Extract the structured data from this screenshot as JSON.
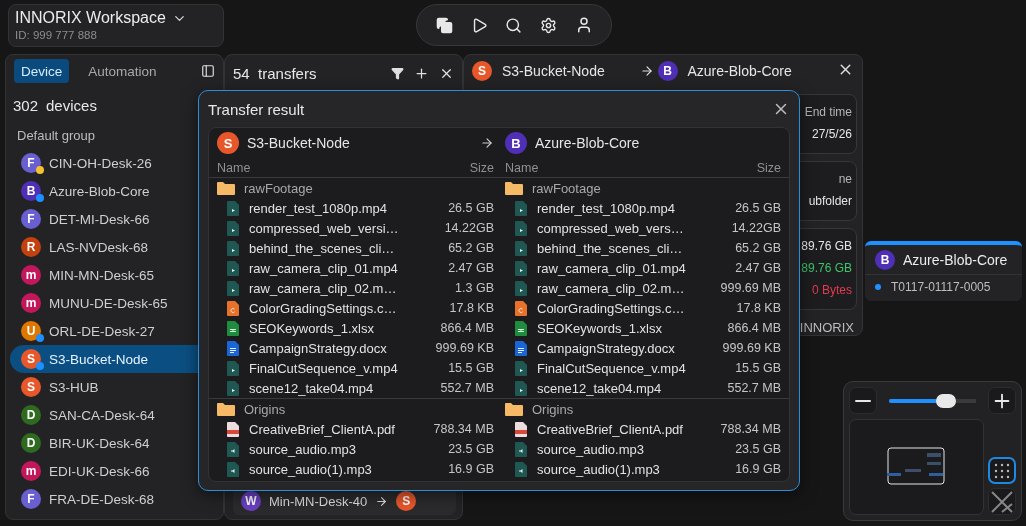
{
  "workspace": {
    "title": "INNORIX Workspace",
    "id": "ID: 999 777 888"
  },
  "device_panel": {
    "tabs": [
      {
        "label": "Device",
        "selected": true
      },
      {
        "label": "Automation",
        "selected": false
      }
    ],
    "count": "302",
    "count_label": "devices",
    "group": "Default group",
    "devices": [
      {
        "name": "CIN-OH-Desk-26",
        "avatar": {
          "letter": "F",
          "color": "#6a5fd0"
        },
        "status_dot": {
          "color": "#f2c230"
        },
        "selected": false
      },
      {
        "name": "Azure-Blob-Core",
        "avatar": {
          "letter": "B",
          "color": "#4f2fb5"
        },
        "status_dot": {
          "color": "#1e8fff"
        },
        "selected": false
      },
      {
        "name": "DET-MI-Desk-66",
        "avatar": {
          "letter": "F",
          "color": "#6a5fd0"
        },
        "selected": false
      },
      {
        "name": "LAS-NVDesk-68",
        "avatar": {
          "letter": "R",
          "color": "#c2410f"
        },
        "selected": false
      },
      {
        "name": "MIN-MN-Desk-65",
        "avatar": {
          "letter": "m",
          "color": "#c2185b"
        },
        "selected": false
      },
      {
        "name": "MUNU-DE-Desk-65",
        "avatar": {
          "letter": "m",
          "color": "#c2185b"
        },
        "selected": false
      },
      {
        "name": "ORL-DE-Desk-27",
        "avatar": {
          "letter": "U",
          "color": "#e07800"
        },
        "status_dot": {
          "color": "#1e8fff"
        },
        "selected": false
      },
      {
        "name": "S3-Bucket-Node",
        "avatar": {
          "letter": "S",
          "color": "#e8572a"
        },
        "status_dot": {
          "color": "#1e8fff"
        },
        "selected": true
      },
      {
        "name": "S3-HUB",
        "avatar": {
          "letter": "S",
          "color": "#e8572a"
        },
        "selected": false
      },
      {
        "name": "SAN-CA-Desk-64",
        "avatar": {
          "letter": "D",
          "color": "#2e6b1f"
        },
        "selected": false
      },
      {
        "name": "BIR-UK-Desk-64",
        "avatar": {
          "letter": "D",
          "color": "#2e6b1f"
        },
        "selected": false
      },
      {
        "name": "EDI-UK-Desk-66",
        "avatar": {
          "letter": "m",
          "color": "#c2185b"
        },
        "selected": false
      },
      {
        "name": "FRA-DE-Desk-68",
        "avatar": {
          "letter": "F",
          "color": "#6a5fd0"
        },
        "selected": false
      }
    ]
  },
  "transfers_panel": {
    "count": "54",
    "count_label": "transfers",
    "rows": [
      {
        "source": {
          "letter": "W",
          "color": "#6a3fc1"
        },
        "name": "Min-MN-Desk-40",
        "target": {
          "letter": "S",
          "color": "#e8572a"
        }
      }
    ]
  },
  "detail_panel": {
    "source": {
      "letter": "S",
      "color": "#e8572a",
      "name": "S3-Bucket-Node"
    },
    "target": {
      "letter": "B",
      "color": "#4f2fb5",
      "name": "Azure-Blob-Core"
    },
    "cards": [
      {
        "lines": [
          {
            "text": "End time",
            "kind": "muted"
          },
          {
            "text": "27/5/26",
            "kind": "normal"
          }
        ]
      },
      {
        "lines": [
          {
            "text": "ne",
            "kind": "muted"
          },
          {
            "text": "ubfolder",
            "kind": "normal"
          }
        ]
      },
      {
        "lines": [
          {
            "text": "89.76 GB",
            "kind": "normal"
          },
          {
            "text": "89.76 GB",
            "kind": "success"
          },
          {
            "text": "0 Bytes",
            "kind": "error"
          }
        ]
      }
    ],
    "footer": "INNORIX"
  },
  "canvas_node": {
    "avatar": {
      "letter": "B",
      "color": "#4f2fb5"
    },
    "name": "Azure-Blob-Core",
    "job": "T0117-01117-0005"
  },
  "zoom": {
    "level": 0.65,
    "grid_selected": true
  },
  "modal": {
    "title": "Transfer result",
    "sides": [
      {
        "device": {
          "letter": "S",
          "color": "#e8572a",
          "name": "S3-Bucket-Node"
        },
        "name_header": "Name",
        "size_header": "Size",
        "groups": [
          {
            "folder": "rawFootage",
            "files": [
              {
                "kind": "video",
                "name": "render_test_1080p.mp4",
                "size": "26.5 GB"
              },
              {
                "kind": "video",
                "name": "compressed_web_versi…",
                "size": "14.22GB"
              },
              {
                "kind": "video",
                "name": "behind_the_scenes_cli…",
                "size": "65.2 GB"
              },
              {
                "kind": "video",
                "name": "raw_camera_clip_01.mp4",
                "size": "2.47 GB"
              },
              {
                "kind": "video",
                "name": "raw_camera_clip_02.m…",
                "size": "1.3 GB"
              },
              {
                "kind": "code",
                "name": "ColorGradingSettings.c…",
                "size": "17.8 KB"
              },
              {
                "kind": "sheet",
                "name": "SEOKeywords_1.xlsx",
                "size": "866.4 MB"
              },
              {
                "kind": "doc",
                "name": "CampaignStrategy.docx",
                "size": "999.69 KB"
              },
              {
                "kind": "video",
                "name": "FinalCutSequence_v.mp4",
                "size": "15.5 GB"
              },
              {
                "kind": "video",
                "name": "scene12_take04.mp4",
                "size": "552.7 MB"
              }
            ]
          },
          {
            "folder": "Origins",
            "files": [
              {
                "kind": "pdf",
                "name": "CreativeBrief_ClientA.pdf",
                "size": "788.34 MB"
              },
              {
                "kind": "audio",
                "name": "source_audio.mp3",
                "size": "23.5 GB"
              },
              {
                "kind": "audio",
                "name": "source_audio(1).mp3",
                "size": "16.9 GB"
              }
            ]
          }
        ]
      },
      {
        "device": {
          "letter": "B",
          "color": "#4f2fb5",
          "name": "Azure-Blob-Core"
        },
        "name_header": "Name",
        "size_header": "Size",
        "groups": [
          {
            "folder": "rawFootage",
            "files": [
              {
                "kind": "video",
                "name": "render_test_1080p.mp4",
                "size": "26.5 GB"
              },
              {
                "kind": "video",
                "name": "compressed_web_vers…",
                "size": "14.22GB"
              },
              {
                "kind": "video",
                "name": "behind_the_scenes_cli…",
                "size": "65.2 GB"
              },
              {
                "kind": "video",
                "name": "raw_camera_clip_01.mp4",
                "size": "2.47 GB"
              },
              {
                "kind": "video",
                "name": "raw_camera_clip_02.m…",
                "size": "999.69 MB"
              },
              {
                "kind": "code",
                "name": "ColorGradingSettings.c…",
                "size": "17.8 KB"
              },
              {
                "kind": "sheet",
                "name": "SEOKeywords_1.xlsx",
                "size": "866.4 MB"
              },
              {
                "kind": "doc",
                "name": "CampaignStrategy.docx",
                "size": "999.69 KB"
              },
              {
                "kind": "video",
                "name": "FinalCutSequence_v.mp4",
                "size": "15.5 GB"
              },
              {
                "kind": "video",
                "name": "scene12_take04.mp4",
                "size": "552.7 MB"
              }
            ]
          },
          {
            "folder": "Origins",
            "files": [
              {
                "kind": "pdf",
                "name": "CreativeBrief_ClientA.pdf",
                "size": "788.34 MB"
              },
              {
                "kind": "audio",
                "name": "source_audio.mp3",
                "size": "23.5 GB"
              },
              {
                "kind": "audio",
                "name": "source_audio(1).mp3",
                "size": "16.9 GB"
              }
            ]
          }
        ]
      }
    ]
  }
}
